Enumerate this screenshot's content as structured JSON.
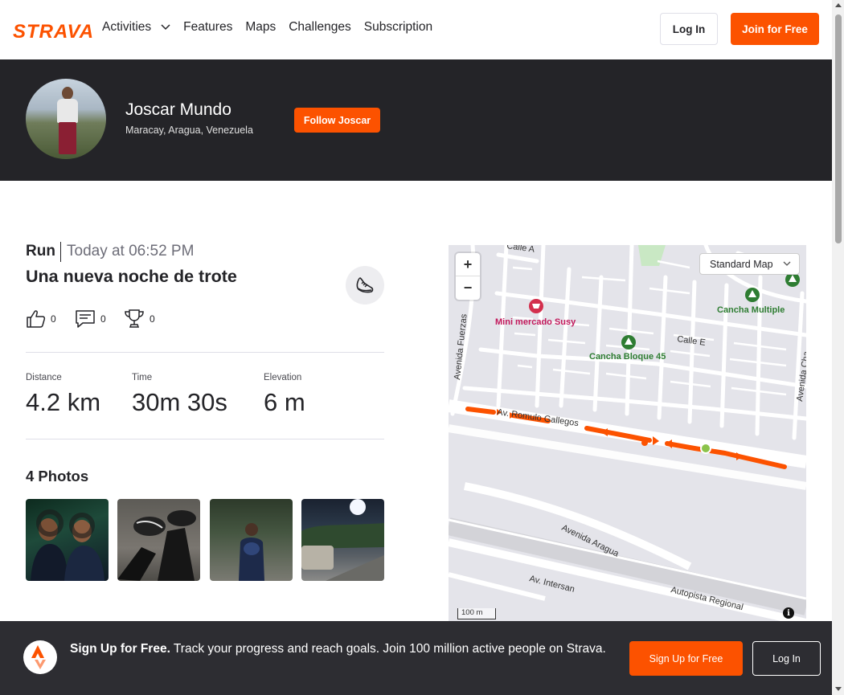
{
  "header": {
    "logo": "STRAVA",
    "nav": [
      {
        "label": "Activities",
        "has_dropdown": true
      },
      {
        "label": "Features"
      },
      {
        "label": "Maps"
      },
      {
        "label": "Challenges"
      },
      {
        "label": "Subscription"
      }
    ],
    "login_label": "Log In",
    "join_label": "Join for Free"
  },
  "athlete": {
    "name": "Joscar Mundo",
    "location": "Maracay, Aragua, Venezuela",
    "follow_label": "Follow Joscar"
  },
  "activity": {
    "type": "Run",
    "time": "Today at 06:52 PM",
    "title": "Una nueva noche de trote",
    "kudos": "0",
    "comments": "0",
    "achievements": "0",
    "stats": [
      {
        "label": "Distance",
        "value": "4.2 km"
      },
      {
        "label": "Time",
        "value": "30m 30s"
      },
      {
        "label": "Elevation",
        "value": "6 m"
      }
    ],
    "photos_title": "4 Photos"
  },
  "map": {
    "style_label": "Standard Map",
    "scale_label": "100 m",
    "labels": {
      "calle_a": "Calle A",
      "calle_e": "Calle E",
      "mini_mercado": "Mini mercado Susy",
      "cancha_bloque": "Cancha Bloque 45",
      "cancha_multiple": "Cancha Multiple",
      "av_fuerzas": "Avenida Fuerzas",
      "av_chacao": "Avenida Cha",
      "av_romulo": "Av. Romulo Gallegos",
      "av_aragua": "Avenida Aragua",
      "av_intersan": "Av. Intersan",
      "autopista": "Autopista Regional"
    }
  },
  "banner": {
    "bold": "Sign Up for Free.",
    "text": "Track your progress and reach goals. Join 100 million active people on Strava.",
    "signup_label": "Sign Up for Free",
    "login_label": "Log In"
  },
  "colors": {
    "brand": "#fc5200",
    "dark": "#242428",
    "route": "#fc5200"
  }
}
